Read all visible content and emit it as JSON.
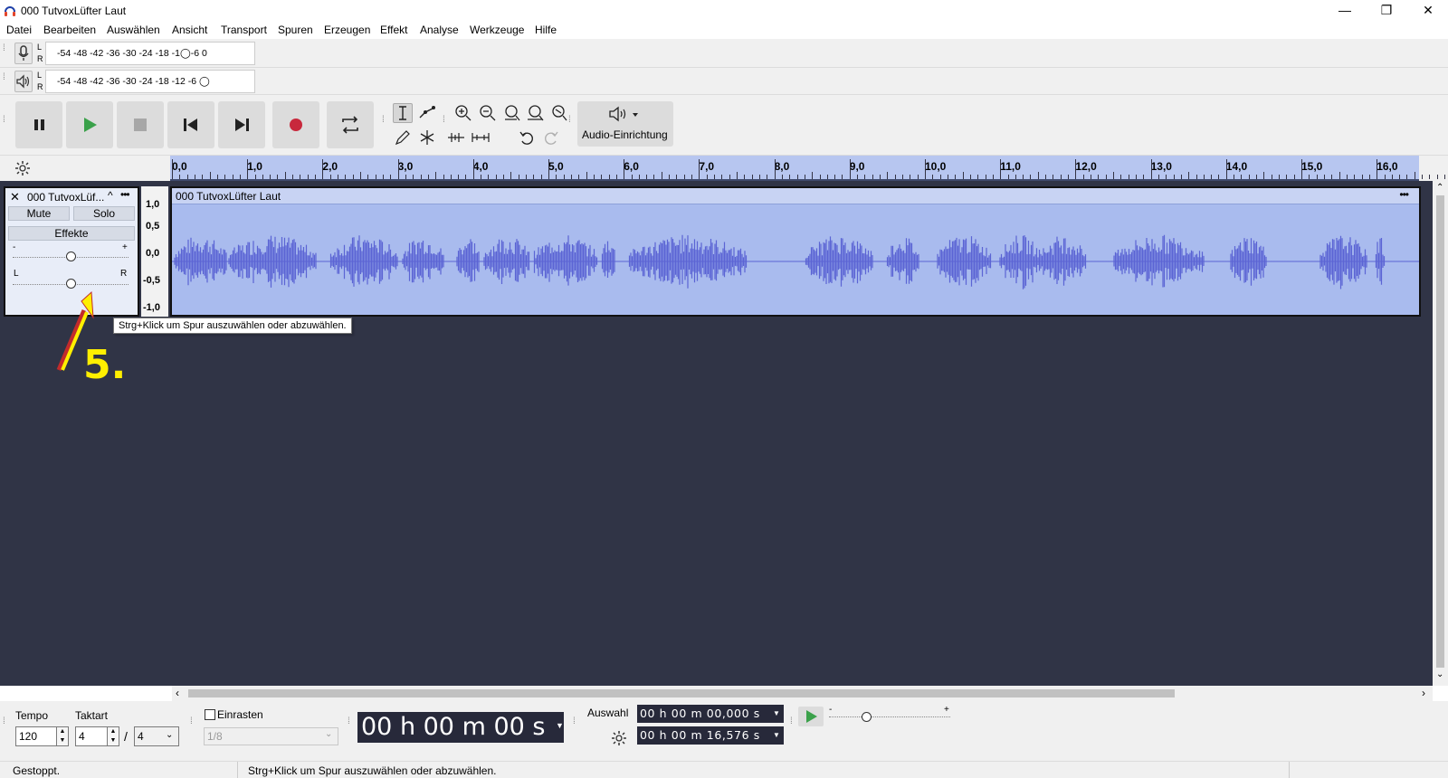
{
  "window": {
    "title": "000 TutvoxLüfter Laut",
    "minimize": "—",
    "restore": "❐",
    "close": "✕"
  },
  "menu": [
    "Datei",
    "Bearbeiten",
    "Auswählen",
    "Ansicht",
    "Transport",
    "Spuren",
    "Erzeugen",
    "Effekt",
    "Analyse",
    "Werkzeuge",
    "Hilfe"
  ],
  "meters": {
    "record_scale": "-54  -48  -42  -36  -30  -24  -18  -1◯-6     0",
    "play_scale": "-54  -48  -42  -36  -30  -24  -18  -12   -6     ◯",
    "L": "L",
    "R": "R"
  },
  "audio_setup": {
    "label": "Audio-Einrichtung"
  },
  "ruler": {
    "ticks": [
      "0,0",
      "1,0",
      "2,0",
      "3,0",
      "4,0",
      "5,0",
      "6,0",
      "7,0",
      "8,0",
      "9,0",
      "10,0",
      "11,0",
      "12,0",
      "13,0",
      "14,0",
      "15,0",
      "16,0"
    ]
  },
  "track": {
    "name": "000 TutvoxLüf...",
    "mute": "Mute",
    "solo": "Solo",
    "effects": "Effekte",
    "gain_minus": "-",
    "gain_plus": "+",
    "pan_left": "L",
    "pan_right": "R",
    "clip_title": "000 TutvoxLüfter Laut",
    "clip_menu": "•••",
    "vscale": [
      "1,0",
      "0,5",
      "0,0",
      "-0,5",
      "-1,0"
    ]
  },
  "tooltip": "Strg+Klick um Spur auszuwählen oder abzuwählen.",
  "annotation": {
    "label": "5."
  },
  "bottom": {
    "tempo_label": "Tempo",
    "tempo_value": "120",
    "taktart_label": "Taktart",
    "taktart_num": "4",
    "taktart_sep": "/",
    "taktart_den": "4",
    "einrasten_label": "Einrasten",
    "snap_value": "1/8",
    "time_display": "00 h 00 m 00 s",
    "auswahl_label": "Auswahl",
    "sel_start": "00 h 00 m 00,000 s",
    "sel_end": "00 h 00 m 16,576 s",
    "speed_minus": "-",
    "speed_plus": "+"
  },
  "status": {
    "state": "Gestoppt.",
    "message": "Strg+Klick um Spur auszuwählen oder abzuwählen."
  },
  "colors": {
    "waveform": "#5b64d4",
    "clip_bg": "#a9bbee",
    "ruler_bg": "#b7c6f0",
    "empty_bg": "#303446",
    "record_red": "#c8283c",
    "play_green": "#3aa14a",
    "annotation_yellow": "#ffef00"
  }
}
